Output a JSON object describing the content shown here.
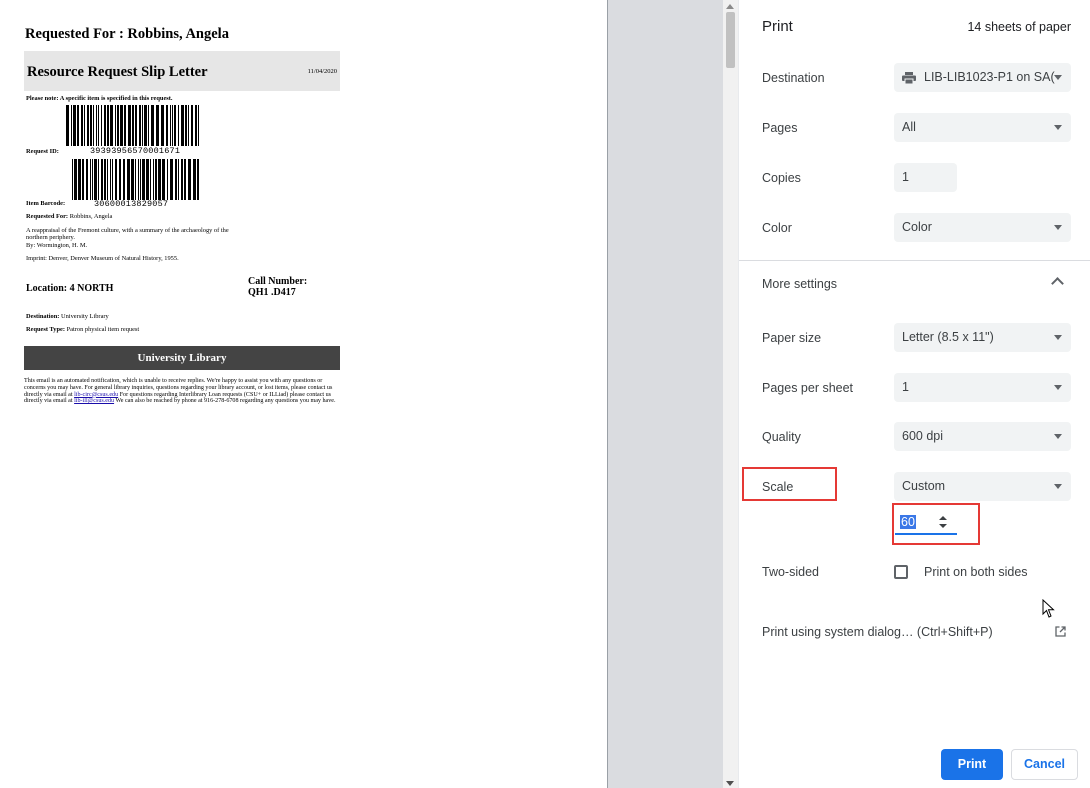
{
  "document": {
    "requested_for": "Requested For : Robbins, Angela",
    "slip_title": "Resource Request Slip Letter",
    "date": "11/04/2020",
    "note": "Please note: A specific item is specified in this request.",
    "request_id_label": "Request ID:",
    "request_id": "39393956570001671",
    "item_barcode_label": "Item Barcode:",
    "item_barcode": "30600013829057",
    "requested_for_label": "Requested For:",
    "requested_for_value": "Robbins, Angela",
    "item_title": "A reappraisal of the Fremont culture, with a summary of the archaeology of the northern periphery.",
    "author": "By: Wormington, H. M.",
    "imprint": "Imprint: Denver, Denver Museum of Natural History, 1955.",
    "location": "Location: 4 NORTH",
    "call_number_label": "Call Number:",
    "call_number": "QH1 .D417",
    "destination_label": "Destination:",
    "destination_value": "University Library",
    "request_type_label": "Request Type:",
    "request_type_value": "Patron physical item request",
    "library_bar": "University Library",
    "footer_1": "This email is an automated notification, which is unable to receive replies. We're happy to assist you with any questions or concerns you may have. For general library inquiries, questions regarding your library account, or lost items, please contact us directly via email at ",
    "footer_email_1": "lib-circ@csus.edu",
    "footer_2": " For questions regarding Interlibrary Loan requests (CSU+ or ILLiad) please contact us directly via email at ",
    "footer_email_2": "lib-ill@csus.edu",
    "footer_3": " We can also be reached by phone at 916-278-6708 regarding any questions you may have."
  },
  "panel": {
    "title": "Print",
    "sheets": "14 sheets of paper",
    "destination_label": "Destination",
    "destination_value": "LIB-LIB1023-P1 on SA(",
    "pages_label": "Pages",
    "pages_value": "All",
    "copies_label": "Copies",
    "copies_value": "1",
    "color_label": "Color",
    "color_value": "Color",
    "more_settings": "More settings",
    "paper_size_label": "Paper size",
    "paper_size_value": "Letter (8.5 x 11\")",
    "pages_per_sheet_label": "Pages per sheet",
    "pages_per_sheet_value": "1",
    "quality_label": "Quality",
    "quality_value": "600 dpi",
    "scale_label": "Scale",
    "scale_value": "Custom",
    "scale_custom": "60",
    "two_sided_label": "Two-sided",
    "two_sided_option": "Print on both sides",
    "system_dialog": "Print using system dialog… (Ctrl+Shift+P)",
    "print_button": "Print",
    "cancel_button": "Cancel"
  },
  "colors": {
    "accent": "#1a73e8",
    "highlight_box": "#e53935",
    "select_bg": "#f1f3f4"
  },
  "icons": [
    "printer-icon",
    "chevron-down-icon",
    "chevron-up-icon",
    "spinner-icon",
    "open-external-icon",
    "mouse-cursor-icon"
  ]
}
